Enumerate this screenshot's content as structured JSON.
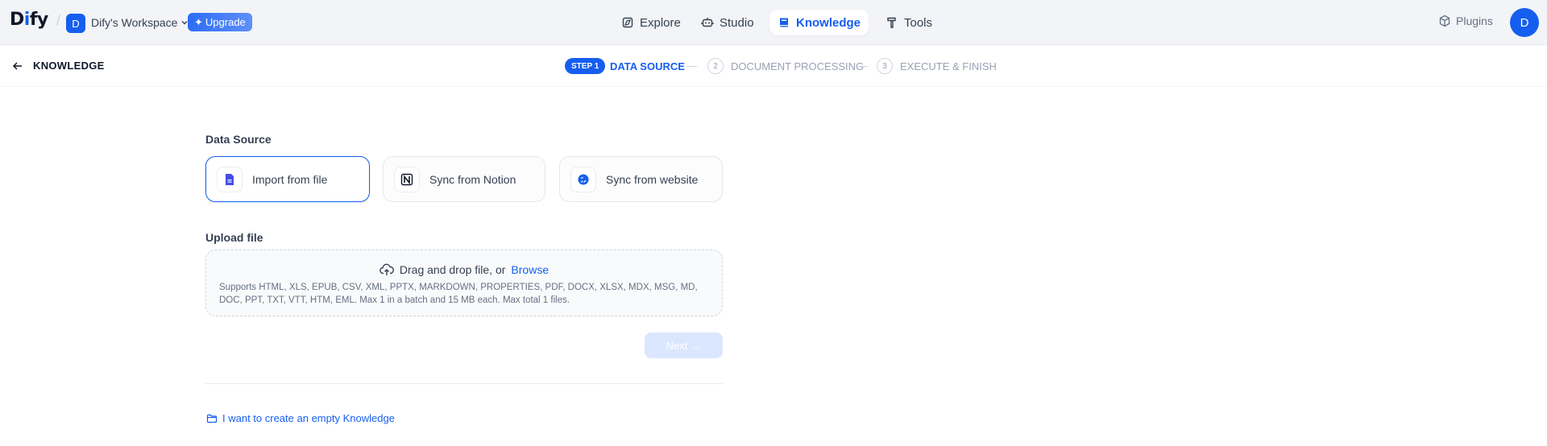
{
  "header": {
    "logo": {
      "part1": "D",
      "dot": "i",
      "part2": "fy"
    },
    "workspace_initial": "D",
    "workspace_name": "Dify's Workspace",
    "upgrade_label": "Upgrade",
    "nav": [
      {
        "label": "Explore",
        "icon": "compass-icon"
      },
      {
        "label": "Studio",
        "icon": "robot-icon"
      },
      {
        "label": "Knowledge",
        "icon": "book-icon",
        "active": true
      },
      {
        "label": "Tools",
        "icon": "hammer-icon"
      }
    ],
    "plugins_label": "Plugins",
    "user_initial": "D"
  },
  "stepbar": {
    "back_label": "KNOWLEDGE",
    "step1_badge": "STEP 1",
    "step1_label": "DATA SOURCE",
    "step2_num": "2",
    "step2_label": "DOCUMENT PROCESSING",
    "step3_num": "3",
    "step3_label": "EXECUTE & FINISH"
  },
  "content": {
    "data_source_title": "Data Source",
    "sources": [
      {
        "label": "Import from file",
        "icon": "file-icon",
        "selected": true
      },
      {
        "label": "Sync from Notion",
        "icon": "notion-icon"
      },
      {
        "label": "Sync from website",
        "icon": "globe-icon"
      }
    ],
    "upload_title": "Upload file",
    "drag_text": "Drag and drop file, or",
    "browse_label": "Browse",
    "support_text": "Supports HTML, XLS, EPUB, CSV, XML, PPTX, MARKDOWN, PROPERTIES, PDF, DOCX, XLSX, MDX, MSG, MD, DOC, PPT, TXT, VTT, HTM, EML. Max 1 in a batch and 15 MB each. Max total 1 files.",
    "next_label": "Next",
    "empty_link": "I want to create an empty Knowledge"
  },
  "colors": {
    "accent": "#155eef",
    "header_bg": "#f2f4f7",
    "text": "#354052",
    "muted": "#98a2b3"
  }
}
